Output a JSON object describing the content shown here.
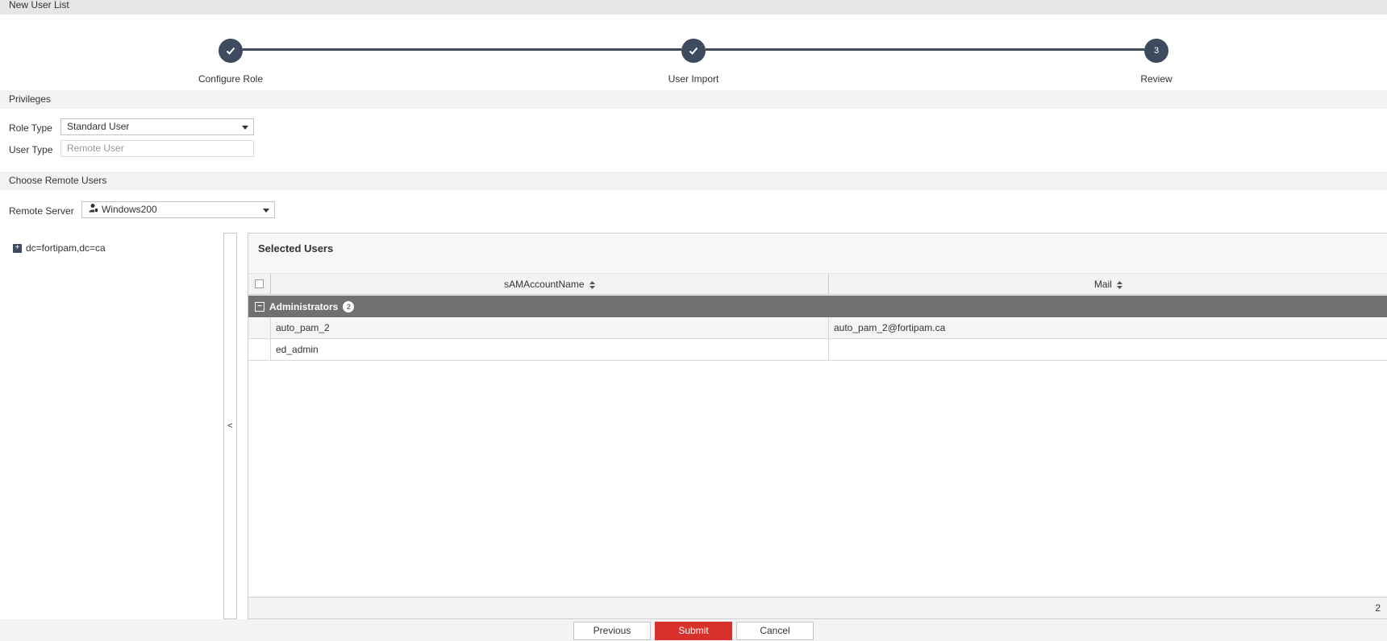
{
  "window": {
    "title": "New User List"
  },
  "stepper": {
    "steps": [
      {
        "label": "Configure Role",
        "state": "complete"
      },
      {
        "label": "User Import",
        "state": "complete"
      },
      {
        "label": "Review",
        "state": "current",
        "number": "3"
      }
    ]
  },
  "privileges": {
    "header": "Privileges",
    "role_type_label": "Role Type",
    "role_type_value": "Standard User",
    "user_type_label": "User Type",
    "user_type_placeholder": "Remote User"
  },
  "remote": {
    "header": "Choose Remote Users",
    "server_label": "Remote Server",
    "server_value": "Windows200"
  },
  "tree": {
    "root_label": "dc=fortipam,dc=ca"
  },
  "collapse_glyph": "<",
  "selected_users": {
    "title": "Selected Users",
    "columns": [
      "sAMAccountName",
      "Mail"
    ],
    "group": {
      "name": "Administrators",
      "count": "2"
    },
    "rows": [
      {
        "sam": "auto_pam_2",
        "mail": "auto_pam_2@fortipam.ca"
      },
      {
        "sam": "ed_admin",
        "mail": ""
      }
    ],
    "total": "2"
  },
  "buttons": {
    "previous": "Previous",
    "submit": "Submit",
    "cancel": "Cancel"
  },
  "colors": {
    "accent": "#3e4a5e",
    "submit": "#d9302c",
    "group_row": "#707070"
  }
}
